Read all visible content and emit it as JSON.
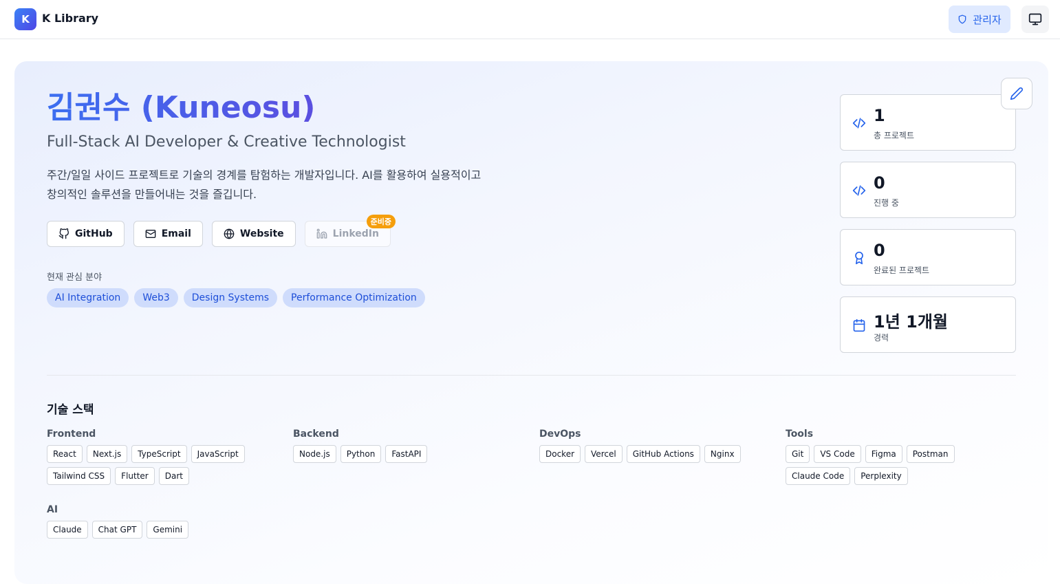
{
  "header": {
    "logo_letter": "K",
    "app_title": "K Library",
    "admin_label": "관리자"
  },
  "profile": {
    "name": "김권수 (Kuneosu)",
    "subtitle": "Full-Stack AI Developer & Creative Technologist",
    "description_line1": "주간/일일 사이드 프로젝트로 기술의 경계를 탐험하는 개발자입니다. AI를 활용하여 실용적이고",
    "description_line2": "창의적인 솔루션을 만들어내는 것을 즐깁니다.",
    "links": [
      {
        "label": "GitHub",
        "icon": "github-icon"
      },
      {
        "label": "Email",
        "icon": "mail-icon"
      },
      {
        "label": "Website",
        "icon": "globe-icon"
      },
      {
        "label": "LinkedIn",
        "icon": "linkedin-icon",
        "badge": "준비중",
        "disabled": true
      }
    ],
    "interests_label": "현재 관심 분야",
    "interests": [
      "AI Integration",
      "Web3",
      "Design Systems",
      "Performance Optimization"
    ]
  },
  "stats": [
    {
      "value": "1",
      "label": "총 프로젝트",
      "icon": "code-icon"
    },
    {
      "value": "0",
      "label": "진행 중",
      "icon": "code-icon"
    },
    {
      "value": "0",
      "label": "완료된 프로젝트",
      "icon": "award-icon"
    },
    {
      "value": "1년 1개월",
      "label": "경력",
      "icon": "calendar-icon"
    }
  ],
  "tech_stack": {
    "title": "기술 스택",
    "categories": [
      {
        "name": "Frontend",
        "items": [
          "React",
          "Next.js",
          "TypeScript",
          "JavaScript",
          "Tailwind CSS",
          "Flutter",
          "Dart"
        ]
      },
      {
        "name": "Backend",
        "items": [
          "Node.js",
          "Python",
          "FastAPI"
        ]
      },
      {
        "name": "DevOps",
        "items": [
          "Docker",
          "Vercel",
          "GitHub Actions",
          "Nginx"
        ]
      },
      {
        "name": "Tools",
        "items": [
          "Git",
          "VS Code",
          "Figma",
          "Postman",
          "Claude Code",
          "Perplexity"
        ]
      },
      {
        "name": "AI",
        "items": [
          "Claude",
          "Chat GPT",
          "Gemini"
        ]
      }
    ]
  },
  "colors": {
    "accent": "#3b6ef0",
    "pill_bg": "#cfdcfc",
    "badge": "#f59e0b"
  }
}
